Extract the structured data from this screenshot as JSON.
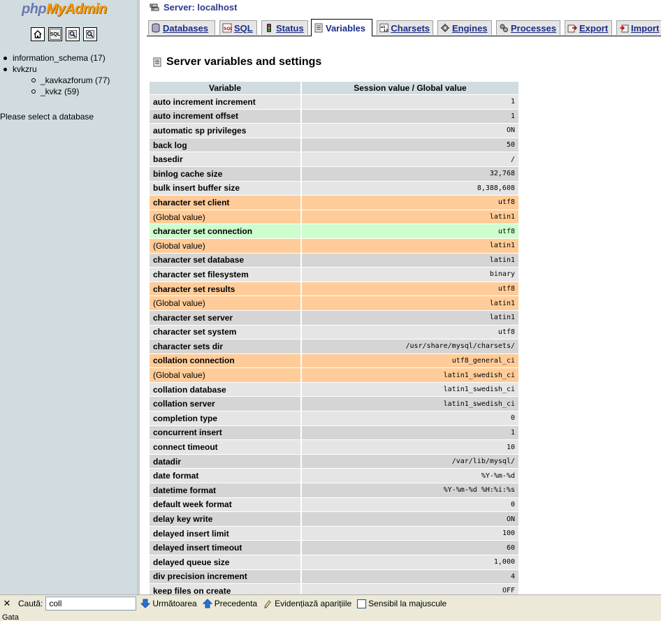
{
  "nav": {
    "logo_php": "php",
    "logo_myadmin": "MyAdmin",
    "quick_buttons": [
      "home",
      "SQL",
      "query",
      "docs"
    ],
    "databases": [
      {
        "label": "information_schema (17)"
      },
      {
        "label": "kvkzru"
      },
      {
        "label": "_kavkazforum (77)"
      },
      {
        "label": "_kvkz (59)"
      }
    ],
    "select_prompt": "Please select a database"
  },
  "header": {
    "server_label": "Server: localhost"
  },
  "tabs": [
    {
      "label": "Databases",
      "icon": "databases-icon"
    },
    {
      "label": "SQL",
      "icon": "sql-icon"
    },
    {
      "label": "Status",
      "icon": "status-icon"
    },
    {
      "label": "Variables",
      "icon": "variables-icon",
      "active": true
    },
    {
      "label": "Charsets",
      "icon": "charsets-icon"
    },
    {
      "label": "Engines",
      "icon": "engines-icon"
    },
    {
      "label": "Processes",
      "icon": "processes-icon"
    },
    {
      "label": "Export",
      "icon": "export-icon"
    },
    {
      "label": "Import",
      "icon": "import-icon"
    }
  ],
  "page": {
    "title": "Server variables and settings",
    "col_variable": "Variable",
    "col_value": "Session value / Global value"
  },
  "variables": [
    {
      "name": "auto increment increment",
      "value": "1"
    },
    {
      "name": "auto increment offset",
      "value": "1"
    },
    {
      "name": "automatic sp privileges",
      "value": "ON"
    },
    {
      "name": "back log",
      "value": "50"
    },
    {
      "name": "basedir",
      "value": "/"
    },
    {
      "name": "binlog cache size",
      "value": "32,768"
    },
    {
      "name": "bulk insert buffer size",
      "value": "8,388,608"
    },
    {
      "name": "character set client",
      "value": "utf8",
      "state": "diff"
    },
    {
      "name": "(Global value)",
      "value": "latin1",
      "state": "diff",
      "global": true
    },
    {
      "name": "character set connection",
      "value": "utf8",
      "state": "marked"
    },
    {
      "name": "(Global value)",
      "value": "latin1",
      "state": "diff",
      "global": true
    },
    {
      "name": "character set database",
      "value": "latin1"
    },
    {
      "name": "character set filesystem",
      "value": "binary"
    },
    {
      "name": "character set results",
      "value": "utf8",
      "state": "diff"
    },
    {
      "name": "(Global value)",
      "value": "latin1",
      "state": "diff",
      "global": true
    },
    {
      "name": "character set server",
      "value": "latin1"
    },
    {
      "name": "character set system",
      "value": "utf8"
    },
    {
      "name": "character sets dir",
      "value": "/usr/share/mysql/charsets/"
    },
    {
      "name": "collation connection",
      "value": "utf8_general_ci",
      "state": "diff"
    },
    {
      "name": "(Global value)",
      "value": "latin1_swedish_ci",
      "state": "diff",
      "global": true
    },
    {
      "name": "collation database",
      "value": "latin1_swedish_ci"
    },
    {
      "name": "collation server",
      "value": "latin1_swedish_ci"
    },
    {
      "name": "completion type",
      "value": "0"
    },
    {
      "name": "concurrent insert",
      "value": "1"
    },
    {
      "name": "connect timeout",
      "value": "10"
    },
    {
      "name": "datadir",
      "value": "/var/lib/mysql/"
    },
    {
      "name": "date format",
      "value": "%Y-%m-%d"
    },
    {
      "name": "datetime format",
      "value": "%Y-%m-%d %H:%i:%s"
    },
    {
      "name": "default week format",
      "value": "0"
    },
    {
      "name": "delay key write",
      "value": "ON"
    },
    {
      "name": "delayed insert limit",
      "value": "100"
    },
    {
      "name": "delayed insert timeout",
      "value": "60"
    },
    {
      "name": "delayed queue size",
      "value": "1,000"
    },
    {
      "name": "div precision increment",
      "value": "4"
    },
    {
      "name": "keep files on create",
      "value": "OFF"
    }
  ],
  "findbar": {
    "close": "✕",
    "label": "Caută:",
    "query": "coll",
    "next": "Următoarea",
    "previous": "Precedenta",
    "highlight": "Evidențiază aparițiile",
    "match_case": "Sensibil la majuscule"
  },
  "status": "Gata"
}
